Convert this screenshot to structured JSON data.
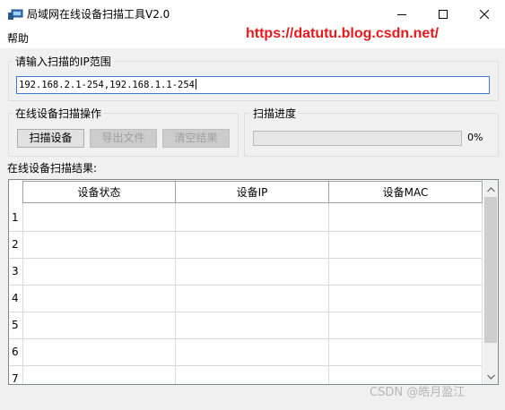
{
  "window": {
    "title": "局域网在线设备扫描工具V2.0",
    "icon": "network-device-icon",
    "controls": [
      "minimize-icon",
      "maximize-icon",
      "close-icon"
    ]
  },
  "menubar": {
    "items": [
      {
        "label": "帮助"
      }
    ]
  },
  "watermark": {
    "url": "https://datutu.blog.csdn.net/",
    "csdn": "CSDN @皓月盈江"
  },
  "ip_range": {
    "title": "请输入扫描的IP范围",
    "value": "192.168.2.1-254,192.168.1.1-254"
  },
  "scan_ops": {
    "title": "在线设备扫描操作",
    "scan_button": "扫描设备",
    "export_button": "导出文件",
    "clear_button": "清空结果"
  },
  "progress": {
    "title": "扫描进度",
    "value": 0,
    "label": "0%"
  },
  "results": {
    "label": "在线设备扫描结果:",
    "columns": [
      "设备状态",
      "设备IP",
      "设备MAC"
    ],
    "row_numbers": [
      "1",
      "2",
      "3",
      "4",
      "5",
      "6",
      "7"
    ]
  },
  "colors": {
    "accent_input_border": "#3d7bd0",
    "watermark_url": "#e8191d"
  }
}
